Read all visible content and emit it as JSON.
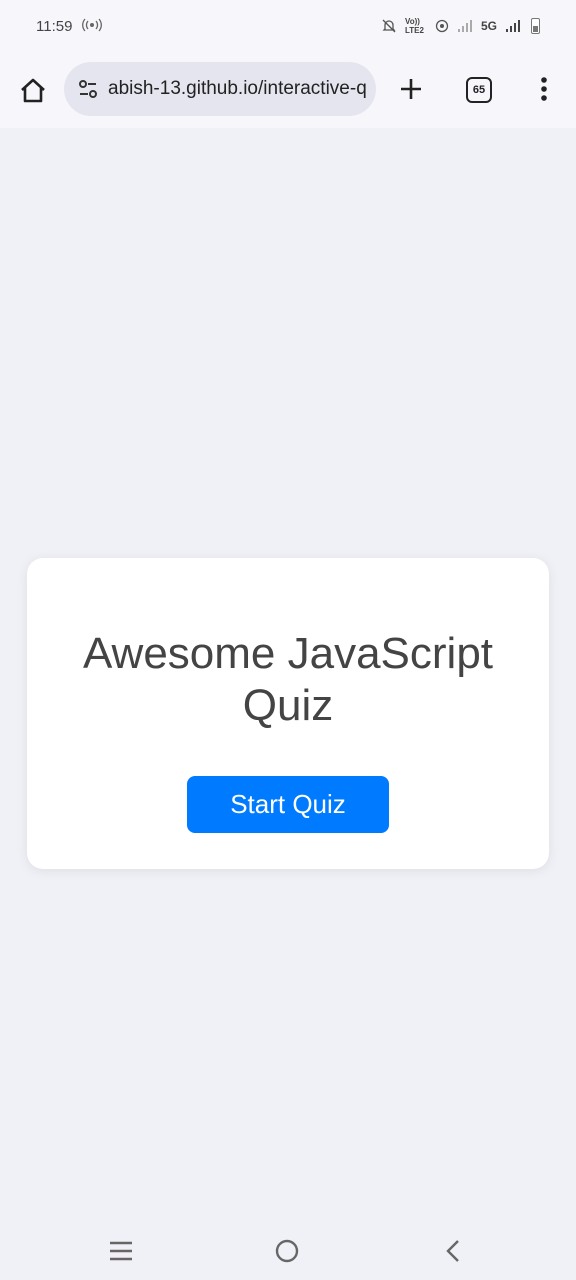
{
  "status_bar": {
    "time": "11:59",
    "hotspot_icon": "hotspot-icon",
    "volte_label": "Vo)) LTE2",
    "network_label": "5G"
  },
  "browser": {
    "url": "abish-13.github.io/interactive-q",
    "tab_count": "65"
  },
  "page": {
    "title": "Awesome JavaScript Quiz",
    "start_button_label": "Start Quiz"
  },
  "colors": {
    "accent": "#007bff",
    "background": "#f0f1f6",
    "card": "#ffffff",
    "title_text": "#444444"
  }
}
